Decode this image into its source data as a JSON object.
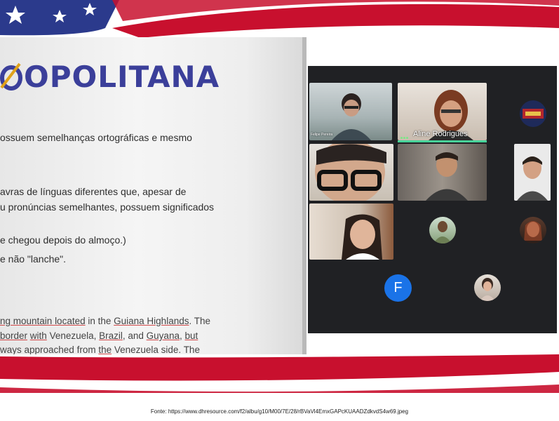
{
  "slide": {
    "brand_text": "OPOLITANA",
    "lines": [
      "ossuem semelhanças ortográficas e mesmo",
      "avras de línguas diferentes que, apesar de",
      "u pronúncias semelhantes, possuem significados",
      "e chegou depois do almoço.)",
      "e não \"lanche\"."
    ],
    "english": {
      "line1": {
        "a": "ng mountain ",
        "b": "located",
        "c": " in the ",
        "d": "Guiana Highlands",
        "e": ". The"
      },
      "line2": {
        "a": "border",
        "b": " ",
        "c": "with",
        "d": " Venezuela, ",
        "e": "Brazil",
        "f": ", and ",
        "g": "Guyana",
        "h": ", ",
        "i": "but"
      },
      "line3": {
        "a": "ways approached from ",
        "b": "the",
        "c": " Venezuela side. The"
      }
    }
  },
  "call": {
    "participants": [
      {
        "name": "Felipe Pereira"
      },
      {
        "name": "Aline Rodrigues",
        "speaking": true
      },
      {
        "name": ""
      },
      {
        "name": ""
      },
      {
        "name": ""
      },
      {
        "name": ""
      },
      {
        "name": ""
      },
      {
        "name": ""
      },
      {
        "name": ""
      },
      {
        "name": ""
      }
    ],
    "initial_avatar": "F"
  },
  "caption": "Fonte: https://www.dhresource.com/f2/albu/g10/M00/7E/28/rBVaVl4EmxGAPcKUAADZdkvdS4w69.jpeg",
  "colors": {
    "flag_red": "#c8102e",
    "flag_blue": "#2b3a8c",
    "meet_bg": "#202124",
    "avatar_blue": "#1a73e8",
    "speaking": "#48d39a"
  },
  "icons": [
    "flag-banner",
    "star-icon",
    "logo-swoosh-icon"
  ]
}
